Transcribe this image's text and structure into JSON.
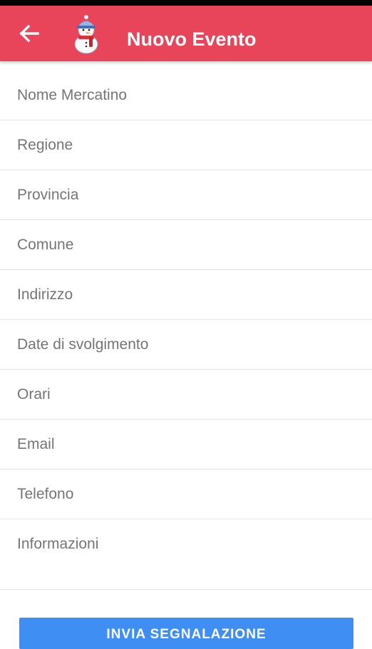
{
  "app_bar": {
    "title": "Nuovo Evento",
    "back_icon": "arrow-left-icon",
    "logo_icon": "snowman-icon",
    "background_color": "#e8455b"
  },
  "form": {
    "fields": [
      {
        "placeholder": "Nome Mercatino",
        "value": ""
      },
      {
        "placeholder": "Regione",
        "value": ""
      },
      {
        "placeholder": "Provincia",
        "value": ""
      },
      {
        "placeholder": "Comune",
        "value": ""
      },
      {
        "placeholder": "Indirizzo",
        "value": ""
      },
      {
        "placeholder": "Date di svolgimento",
        "value": ""
      },
      {
        "placeholder": "Orari",
        "value": ""
      },
      {
        "placeholder": "Email",
        "value": ""
      },
      {
        "placeholder": "Telefono",
        "value": ""
      },
      {
        "placeholder": "Informazioni",
        "value": ""
      }
    ]
  },
  "submit": {
    "label": "INVIA SEGNALAZIONE",
    "color": "#3f8ef4"
  }
}
